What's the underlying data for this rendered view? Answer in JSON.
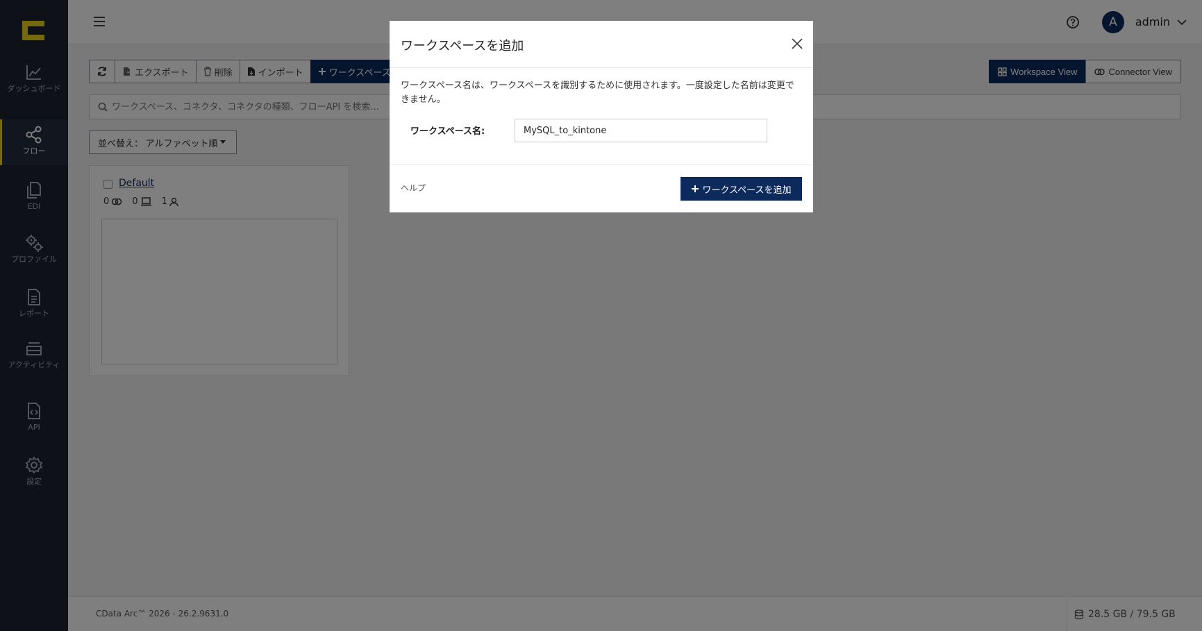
{
  "sidebar": {
    "items": [
      {
        "label": "ダッシュボード",
        "icon": "chart-line-icon"
      },
      {
        "label": "フロー",
        "icon": "share-nodes-icon"
      },
      {
        "label": "EDI",
        "icon": "documents-icon"
      },
      {
        "label": "プロファイル",
        "icon": "gears-icon"
      },
      {
        "label": "レポート",
        "icon": "file-text-icon"
      },
      {
        "label": "アクティビティ",
        "icon": "layers-icon"
      },
      {
        "label": "API",
        "icon": "file-code-icon"
      },
      {
        "label": "設定",
        "icon": "gear-icon"
      }
    ],
    "active": "フロー"
  },
  "header": {
    "user": "admin",
    "avatar_letter": "A"
  },
  "toolbar": {
    "export": "エクスポート",
    "delete": "削除",
    "import": "インポート",
    "add_workspace": "ワークスペースを追加"
  },
  "views": {
    "workspace": "Workspace View",
    "connector": "Connector View"
  },
  "search": {
    "placeholder": "ワークスペース、コネクタ、コネクタの種類、フローAPI を検索..."
  },
  "sort": {
    "label": "並べ替え： アルファベット順"
  },
  "workspace_card": {
    "name": "Default",
    "connectors": "0",
    "flows": "0",
    "users": "1"
  },
  "footer": {
    "version": "CData Arc™ 2026 - 26.2.9631.0",
    "disk": "28.5 GB / 79.5 GB"
  },
  "modal": {
    "title": "ワークスペースを追加",
    "description": "ワークスペース名は、ワークスペースを識別するために使用されます。一度設定した名前は変更できません。",
    "field_label": "ワークスペース名:",
    "field_value": "MySQL_to_kintone",
    "help": "ヘルプ",
    "submit": "ワークスペースを追加"
  },
  "colors": {
    "accent": "#0d2a5c",
    "sidebar": "#1c2230",
    "logo": "#e8d21d"
  }
}
